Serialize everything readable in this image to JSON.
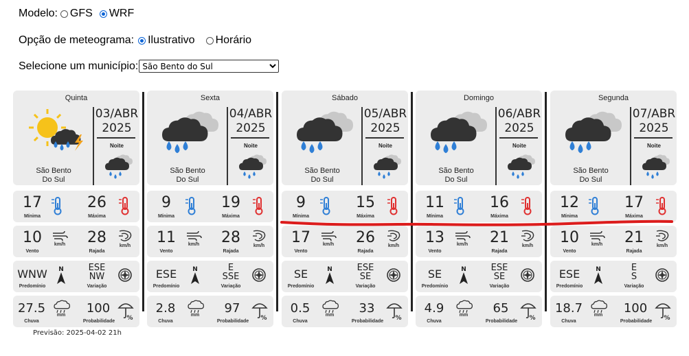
{
  "modelo": {
    "label": "Modelo:",
    "options": [
      "GFS",
      "WRF"
    ],
    "selected": "WRF"
  },
  "opcao": {
    "label": "Opção de meteograma:",
    "options": [
      "Ilustrativo",
      "Horário"
    ],
    "selected": "Ilustrativo"
  },
  "municipio": {
    "label": "Selecione um município:",
    "selected": "São Bento do Sul"
  },
  "labels": {
    "noite": "Noite",
    "minima": "Mínima",
    "maxima": "Máxima",
    "vento": "Vento",
    "rajada": "Rajada",
    "kmh": "km/h",
    "predominio": "Predomínio",
    "variacao": "Variação",
    "chuva": "Chuva",
    "mm": "mm",
    "probabilidade": "Probabilidade",
    "city1": "São Bento",
    "city2": "Do Sul",
    "north": "N",
    "pct": "%"
  },
  "days": [
    {
      "name": "Quinta",
      "date1": "03/ABR",
      "date2": "2025",
      "min": "17",
      "max": "26",
      "vento": "10",
      "rajada": "28",
      "pred": "WNW",
      "var1": "ESE",
      "var2": "NW",
      "chuva": "27.5",
      "prob": "100"
    },
    {
      "name": "Sexta",
      "date1": "04/ABR",
      "date2": "2025",
      "min": "9",
      "max": "19",
      "vento": "11",
      "rajada": "28",
      "pred": "ESE",
      "var1": "E",
      "var2": "SSE",
      "chuva": "2.8",
      "prob": "97"
    },
    {
      "name": "Sábado",
      "date1": "05/ABR",
      "date2": "2025",
      "min": "9",
      "max": "15",
      "vento": "17",
      "rajada": "26",
      "pred": "SE",
      "var1": "ESE",
      "var2": "SE",
      "chuva": "0.5",
      "prob": "33"
    },
    {
      "name": "Domingo",
      "date1": "06/ABR",
      "date2": "2025",
      "min": "11",
      "max": "16",
      "vento": "13",
      "rajada": "21",
      "pred": "SE",
      "var1": "ESE",
      "var2": "SE",
      "chuva": "4.9",
      "prob": "65"
    },
    {
      "name": "Segunda",
      "date1": "07/ABR",
      "date2": "2025",
      "min": "12",
      "max": "17",
      "vento": "10",
      "rajada": "21",
      "pred": "ESE",
      "var1": "E",
      "var2": "S",
      "chuva": "18.7",
      "prob": "100"
    }
  ],
  "previsao": "Previsão: 2025-04-02 21h",
  "colors": {
    "card_bg": "#ececec",
    "red_marker": "#dc1c1c",
    "drop_blue": "#2f7fd6",
    "cloud_dark": "#333333",
    "cloud_light": "#c8c8c8",
    "sun": "#f6c21a",
    "cold_icon": "#2f7fd6",
    "hot_icon": "#e03030"
  }
}
